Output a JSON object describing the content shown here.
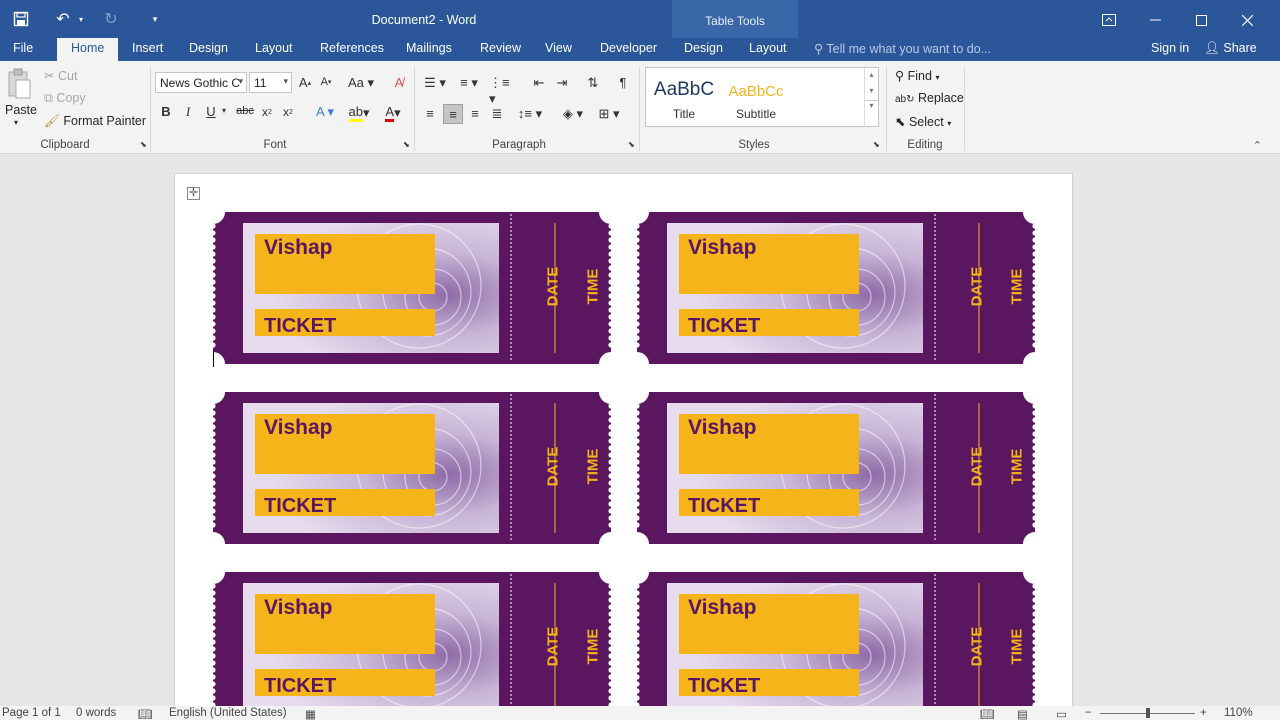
{
  "window": {
    "title": "Document2 - Word",
    "contextual_tab_group": "Table Tools"
  },
  "tabs": {
    "file": "File",
    "home": "Home",
    "insert": "Insert",
    "design": "Design",
    "layout": "Layout",
    "references": "References",
    "mailings": "Mailings",
    "review": "Review",
    "view": "View",
    "developer": "Developer",
    "table_design": "Design",
    "table_layout": "Layout",
    "tell_me": "Tell me what you want to do...",
    "sign_in": "Sign in",
    "share": "Share"
  },
  "ribbon": {
    "clipboard": {
      "paste": "Paste",
      "cut": "Cut",
      "copy": "Copy",
      "format_painter": "Format Painter",
      "label": "Clipboard"
    },
    "font": {
      "font_name": "News Gothic C",
      "font_size": "11",
      "label": "Font"
    },
    "paragraph": {
      "label": "Paragraph"
    },
    "styles": {
      "items": [
        {
          "preview": "AaBbC",
          "name": "Title",
          "color": "#1f3864"
        },
        {
          "preview": "AaBbCc",
          "name": "Subtitle",
          "color": "#f4b41a"
        }
      ],
      "label": "Styles"
    },
    "editing": {
      "find": "Find",
      "replace": "Replace",
      "select": "Select",
      "label": "Editing"
    }
  },
  "tickets": {
    "name": "Vishap",
    "label": "TICKET",
    "date": "DATE",
    "time": "TIME",
    "count": 6,
    "colors": {
      "purple": "#5a1760",
      "gold": "#f4b41a",
      "photo": "#b8a3c7"
    }
  },
  "status": {
    "page": "Page 1 of 1",
    "words": "0 words",
    "language": "English (United States)",
    "zoom": "110%"
  }
}
